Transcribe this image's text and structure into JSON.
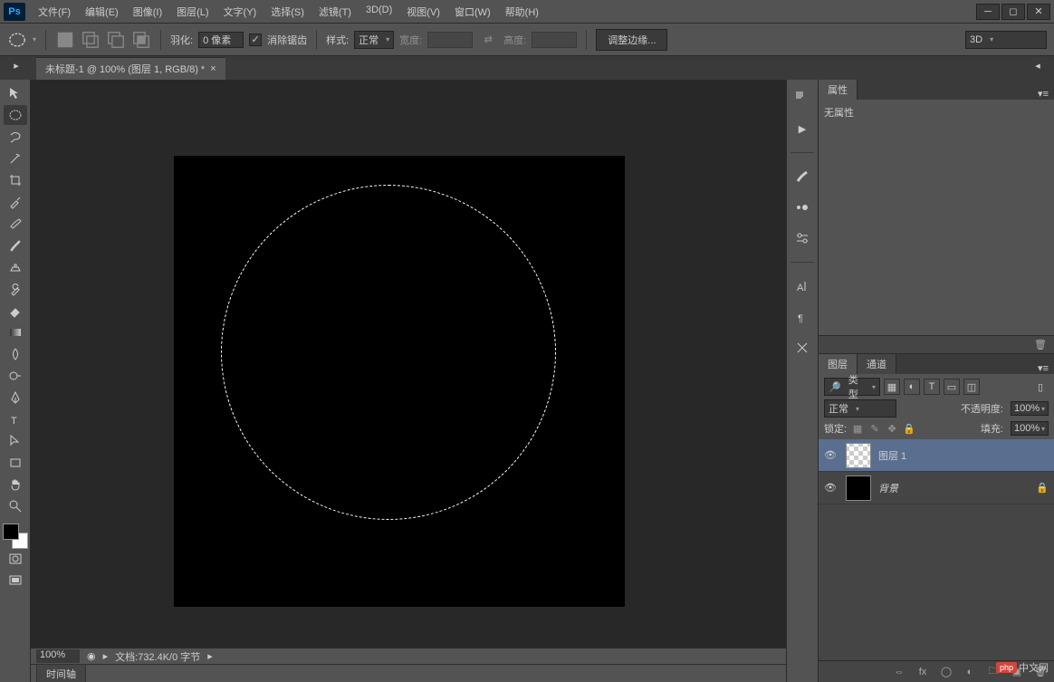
{
  "app": {
    "name": "Ps"
  },
  "menu": {
    "file": "文件(F)",
    "edit": "编辑(E)",
    "image": "图像(I)",
    "layer": "图层(L)",
    "type": "文字(Y)",
    "select": "选择(S)",
    "filter": "滤镜(T)",
    "threeD": "3D(D)",
    "view": "视图(V)",
    "window": "窗口(W)",
    "help": "帮助(H)"
  },
  "options": {
    "feather_label": "羽化:",
    "feather_value": "0 像素",
    "antialias_label": "消除锯齿",
    "style_label": "样式:",
    "style_value": "正常",
    "width_label": "宽度:",
    "height_label": "高度:",
    "refine_edge": "调整边缘...",
    "workspace": "3D"
  },
  "document": {
    "tab_title": "未标题-1 @ 100% (图层 1, RGB/8) *"
  },
  "status": {
    "zoom": "100%",
    "doc_info": "文档:732.4K/0 字节"
  },
  "timeline": {
    "tab": "时间轴"
  },
  "panels": {
    "properties": {
      "tab": "属性",
      "content": "无属性"
    },
    "layers": {
      "tabs": {
        "layers": "图层",
        "channels": "通道"
      },
      "kind_label": "类型",
      "blend_mode": "正常",
      "opacity_label": "不透明度:",
      "opacity_value": "100%",
      "lock_label": "锁定:",
      "fill_label": "填充:",
      "fill_value": "100%",
      "rows": [
        {
          "name": "图层 1",
          "selected": true,
          "thumb": "checker",
          "visible": true,
          "locked": false
        },
        {
          "name": "背景",
          "selected": false,
          "thumb": "black",
          "visible": true,
          "locked": true
        }
      ]
    }
  },
  "watermark": {
    "badge": "php",
    "text": "中文网"
  }
}
